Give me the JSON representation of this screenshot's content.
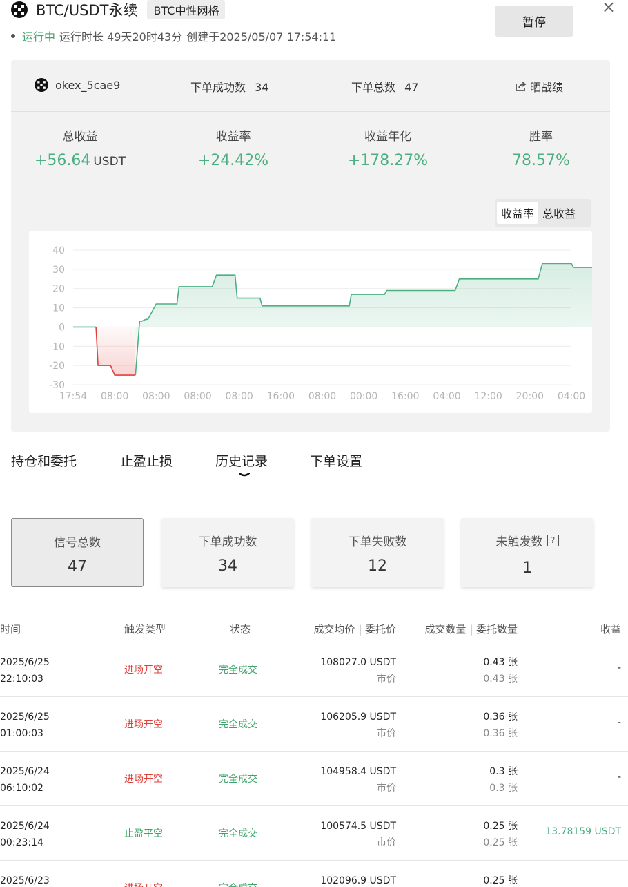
{
  "header": {
    "title": "BTC/USDT永续",
    "tag": "BTC中性网格",
    "pause_label": "暂停",
    "close_glyph": "×",
    "status": "运行中",
    "runtime": "运行时长 49天20时43分",
    "created": "创建于2025/05/07 17:54:11"
  },
  "summary": {
    "account": "okex_5cae9",
    "success_orders_label": "下单成功数",
    "success_orders": "34",
    "total_orders_label": "下单总数",
    "total_orders": "47",
    "share_label": "晒战绩"
  },
  "stats": [
    {
      "label": "总收益",
      "value": "+56.64",
      "unit": "USDT"
    },
    {
      "label": "收益率",
      "value": "+24.42%"
    },
    {
      "label": "收益年化",
      "value": "+178.27%"
    },
    {
      "label": "胜率",
      "value": "78.57%"
    }
  ],
  "chart_toggle": {
    "option_a": "收益率",
    "option_b": "总收益",
    "active": "收益率"
  },
  "chart_data": {
    "type": "area",
    "ylim": [
      -30,
      40
    ],
    "yticks": [
      "40",
      "30",
      "20",
      "10",
      "0",
      "-10",
      "-20",
      "-30"
    ],
    "xticks": [
      "17:54",
      "08:00",
      "08:00",
      "08:00",
      "08:00",
      "16:00",
      "08:00",
      "00:00",
      "16:00",
      "04:00",
      "12:00",
      "20:00",
      "04:00"
    ],
    "series": [
      {
        "x": [
          0,
          0.55,
          0.6,
          0.9,
          1.0,
          1.5,
          1.6,
          1.65,
          1.75,
          1.8,
          2.0,
          2.05,
          2.1,
          2.5,
          2.55,
          2.6,
          3.35,
          3.45,
          3.5,
          3.9,
          3.95,
          4.0,
          4.5,
          4.55,
          4.6,
          5.4,
          5.45,
          5.5,
          6.65,
          6.7,
          6.75,
          7.5,
          7.55,
          7.6,
          9.2,
          9.3,
          9.4,
          11.2,
          11.3,
          11.4,
          12.0,
          12.05,
          12.1,
          12.6,
          12.7,
          12.75,
          13.0
        ],
        "y": [
          0,
          0,
          -20,
          -20,
          -25,
          -25,
          3,
          3,
          4,
          4,
          12,
          12,
          12,
          12,
          21,
          21,
          21,
          27,
          27,
          27,
          15,
          15,
          15,
          11,
          11,
          11,
          11,
          11,
          11,
          17,
          17,
          17,
          19,
          19,
          19,
          25,
          25,
          25,
          33,
          33,
          33,
          31,
          31,
          31,
          25,
          25,
          25
        ]
      }
    ],
    "grid": true
  },
  "tabs": [
    "持仓和委托",
    "止盈止损",
    "历史记录",
    "下单设置"
  ],
  "active_tab": "历史记录",
  "cards": [
    {
      "label": "信号总数",
      "value": "47"
    },
    {
      "label": "下单成功数",
      "value": "34"
    },
    {
      "label": "下单失败数",
      "value": "12"
    },
    {
      "label": "未触发数",
      "value": "1",
      "help": "?"
    }
  ],
  "table": {
    "headers": [
      "时间",
      "触发类型",
      "状态",
      "成交均价 | 委托价",
      "成交数量 | 委托数量",
      "收益"
    ],
    "rows": [
      {
        "date": "2025/6/25",
        "time": "22:10:03",
        "trigger": "进场开空",
        "status": "完全成交",
        "price": "108027.0 USDT",
        "order_price": "市价",
        "qty": "0.43 张",
        "order_qty": "0.43 张",
        "profit": "-"
      },
      {
        "date": "2025/6/25",
        "time": "01:00:03",
        "trigger": "进场开空",
        "status": "完全成交",
        "price": "106205.9 USDT",
        "order_price": "市价",
        "qty": "0.36 张",
        "order_qty": "0.36 张",
        "profit": "-"
      },
      {
        "date": "2025/6/24",
        "time": "06:10:02",
        "trigger": "进场开空",
        "status": "完全成交",
        "price": "104958.4 USDT",
        "order_price": "市价",
        "qty": "0.3 张",
        "order_qty": "0.3 张",
        "profit": "-"
      },
      {
        "date": "2025/6/24",
        "time": "00:23:14",
        "trigger": "止盈平空",
        "status": "完全成交",
        "price": "100574.5 USDT",
        "order_price": "市价",
        "qty": "0.25 张",
        "order_qty": "0.25 张",
        "profit": "13.78159 USDT"
      },
      {
        "date": "2025/6/23",
        "time": "",
        "trigger": "进场开空",
        "status": "完全成交",
        "price": "102096.9 USDT",
        "order_price": "",
        "qty": "0.25 张",
        "order_qty": "",
        "profit": ""
      }
    ]
  },
  "colors": {
    "positive": "#4caf82",
    "negative": "#e0403a",
    "status_green": "#3fa36a"
  }
}
